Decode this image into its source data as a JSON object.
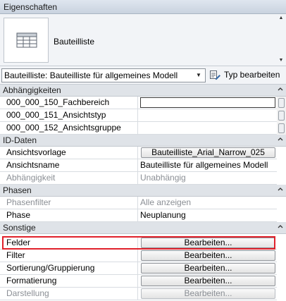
{
  "palette": {
    "titlebar": "#c9d3df",
    "group_header": "#dfe3e8",
    "highlight": "#e0212b"
  },
  "titlebar": {
    "title": "Eigenschaften"
  },
  "type_selector": {
    "thumbnail_icon": "schedule-table-icon",
    "type_name": "Bauteilliste"
  },
  "instance_selector": {
    "value": "Bauteilliste: Bauteilliste für allgemeines Modell",
    "edit_type_label": "Typ bearbeiten",
    "edit_type_icon": "edit-type-icon"
  },
  "groups": [
    {
      "label": "Abhängigkeiten",
      "rows": [
        {
          "name": "000_000_150_Fachbereich",
          "value": ""
        },
        {
          "name": "000_000_151_Ansichtstyp",
          "value": ""
        },
        {
          "name": "000_000_152_Ansichtsgruppe",
          "value": ""
        }
      ]
    },
    {
      "label": "ID-Daten",
      "rows": [
        {
          "name": "Ansichtsvorlage",
          "value": "Bauteilliste_Arial_Narrow_025"
        },
        {
          "name": "Ansichtsname",
          "value": "Bauteilliste für allgemeines Modell"
        },
        {
          "name": "Abhängigkeit",
          "value": "Unabhängig"
        }
      ]
    },
    {
      "label": "Phasen",
      "rows": [
        {
          "name": "Phasenfilter",
          "value": "Alle anzeigen"
        },
        {
          "name": "Phase",
          "value": "Neuplanung"
        }
      ]
    },
    {
      "label": "Sonstige",
      "rows": [
        {
          "name": "Felder",
          "value": "Bearbeiten..."
        },
        {
          "name": "Filter",
          "value": "Bearbeiten..."
        },
        {
          "name": "Sortierung/Gruppierung",
          "value": "Bearbeiten..."
        },
        {
          "name": "Formatierung",
          "value": "Bearbeiten..."
        },
        {
          "name": "Darstellung",
          "value": "Bearbeiten..."
        }
      ]
    }
  ]
}
